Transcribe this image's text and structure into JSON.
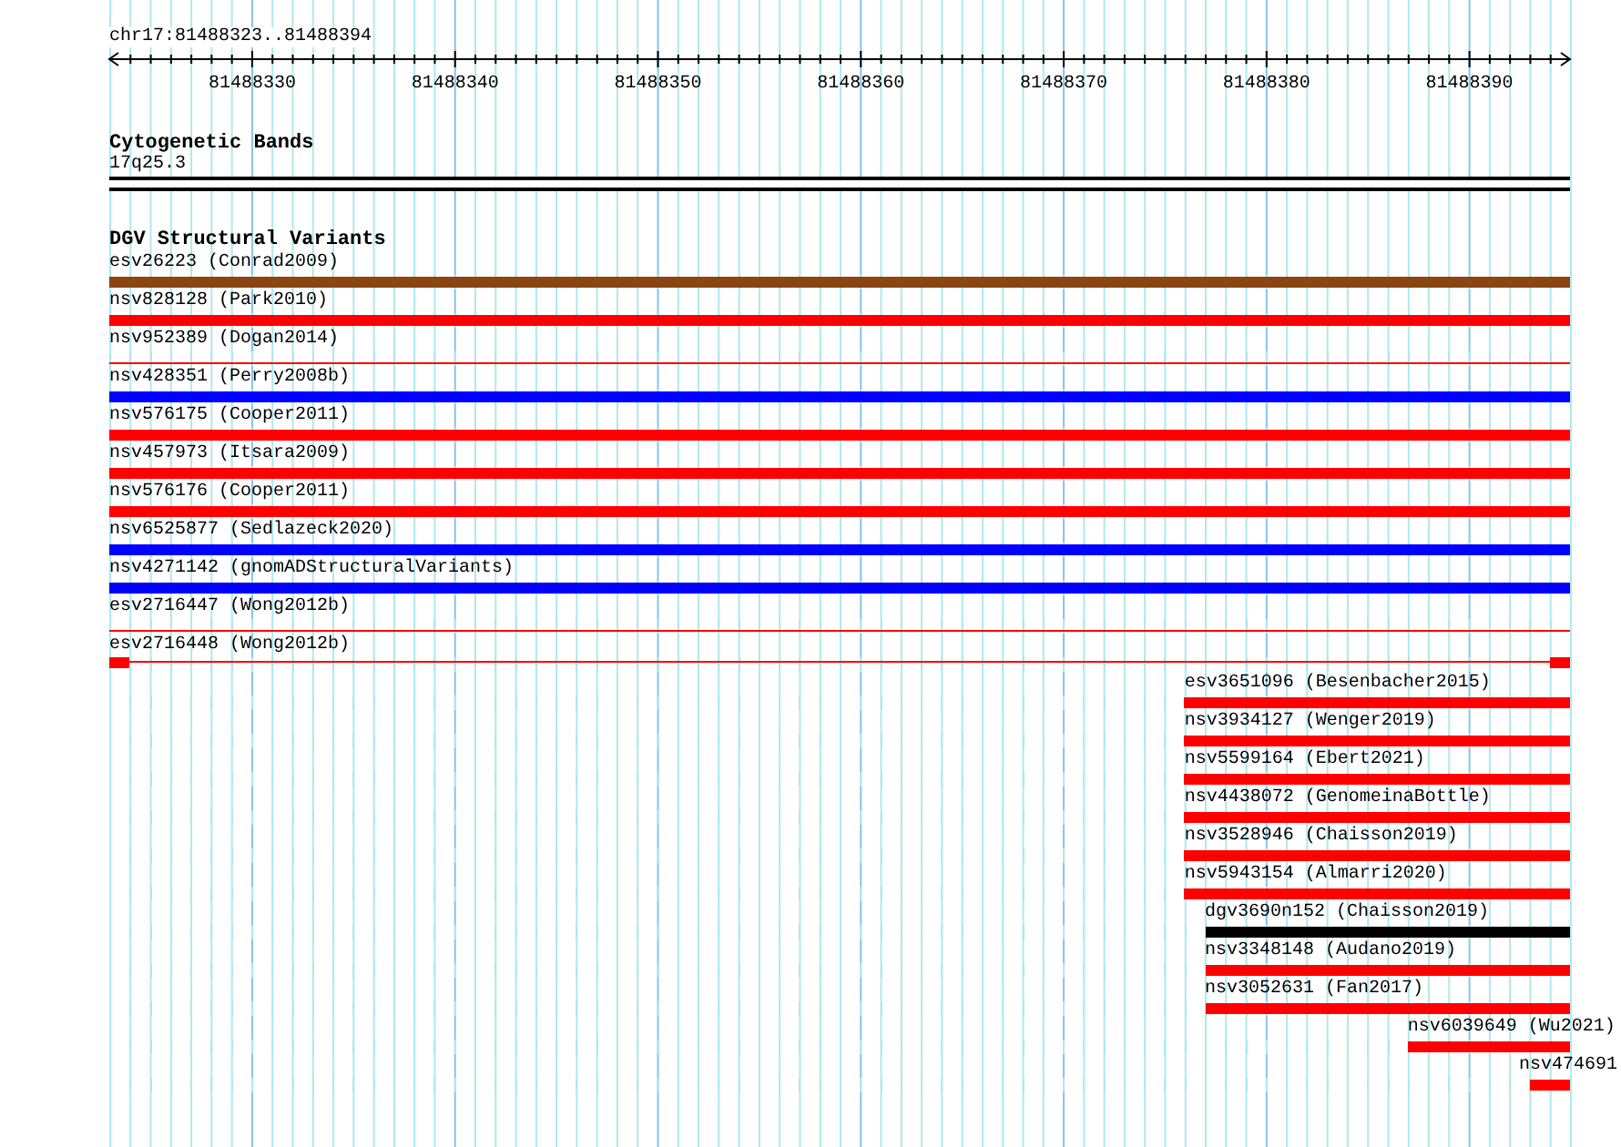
{
  "ruler": {
    "title": "chr17:81488323..81488394",
    "ticks": [
      "81488330",
      "81488340",
      "81488350",
      "81488360",
      "81488370",
      "81488380",
      "81488390"
    ]
  },
  "cytogenetic": {
    "title": "Cytogenetic Bands",
    "band": "17q25.3"
  },
  "dgv": {
    "title": "DGV Structural Variants",
    "features": [
      {
        "label": "esv26223 (Conrad2009)",
        "kind": "bar",
        "color": "#8b4513",
        "level": 1
      },
      {
        "label": "nsv828128 (Park2010)",
        "kind": "bar",
        "color": "#ff0000",
        "level": 1
      },
      {
        "label": "nsv952389 (Dogan2014)",
        "kind": "line",
        "color": "#ff0000",
        "level": 1
      },
      {
        "label": "nsv428351 (Perry2008b)",
        "kind": "bar",
        "color": "#0000ff",
        "level": 1
      },
      {
        "label": "nsv576175 (Cooper2011)",
        "kind": "bar",
        "color": "#ff0000",
        "level": 1
      },
      {
        "label": "nsv457973 (Itsara2009)",
        "kind": "bar",
        "color": "#ff0000",
        "level": 1
      },
      {
        "label": "nsv576176 (Cooper2011)",
        "kind": "bar",
        "color": "#ff0000",
        "level": 1
      },
      {
        "label": "nsv6525877 (Sedlazeck2020)",
        "kind": "bar",
        "color": "#0000ff",
        "level": 1
      },
      {
        "label": "nsv4271142 (gnomADStructuralVariants)",
        "kind": "bar",
        "color": "#0000ff",
        "level": 1
      },
      {
        "label": "esv2716447 (Wong2012b)",
        "kind": "line",
        "color": "#ff0000",
        "level": 1
      },
      {
        "label": "esv2716448 (Wong2012b)",
        "kind": "split",
        "color": "#ff0000",
        "level": 1
      },
      {
        "label": "esv3651096 (Besenbacher2015)",
        "kind": "bar",
        "color": "#ff0000",
        "level": 0.2639
      },
      {
        "label": "nsv3934127 (Wenger2019)",
        "kind": "bar",
        "color": "#ff0000",
        "level": 0.2639
      },
      {
        "label": "nsv5599164 (Ebert2021)",
        "kind": "bar",
        "color": "#ff0000",
        "level": 0.2639
      },
      {
        "label": "nsv4438072 (GenomeinaBottle)",
        "kind": "bar",
        "color": "#ff0000",
        "level": 0.2639
      },
      {
        "label": "nsv3528946 (Chaisson2019)",
        "kind": "bar",
        "color": "#ff0000",
        "level": 0.2639
      },
      {
        "label": "nsv5943154 (Almarri2020)",
        "kind": "bar",
        "color": "#ff0000",
        "level": 0.2639
      },
      {
        "label": "dgv3690n152 (Chaisson2019)",
        "kind": "bar",
        "color": "#000000",
        "level": 0.25
      },
      {
        "label": "nsv3348148 (Audano2019)",
        "kind": "bar",
        "color": "#ff0000",
        "level": 0.25
      },
      {
        "label": "nsv3052631 (Fan2017)",
        "kind": "bar",
        "color": "#ff0000",
        "level": 0.25
      },
      {
        "label": "nsv6039649 (Wu2021)",
        "kind": "bar",
        "color": "#ff0000",
        "level": 0.1111
      },
      {
        "label": "nsv474691",
        "kind": "bar",
        "color": "#ff0000",
        "level": 0.0278
      }
    ]
  }
}
